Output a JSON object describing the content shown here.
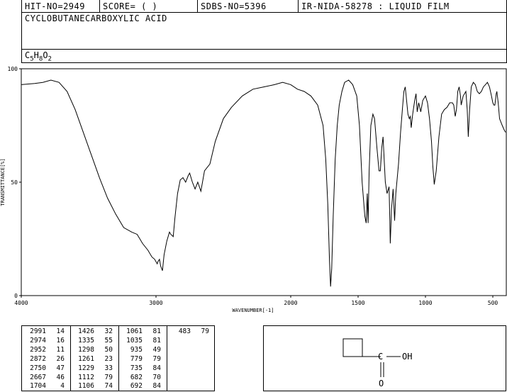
{
  "header": {
    "hit_no": "HIT-NO=2949",
    "score": "SCORE=  (   )",
    "sdbs_no": "SDBS-NO=5396",
    "ir_nida": "IR-NIDA-58278 : LIQUID FILM"
  },
  "compound": {
    "name": "CYCLOBUTANECARBOXYLIC ACID",
    "formula_parts": [
      {
        "t": "C",
        "sub": false
      },
      {
        "t": "5",
        "sub": true
      },
      {
        "t": "H",
        "sub": false
      },
      {
        "t": "8",
        "sub": true
      },
      {
        "t": "O",
        "sub": false
      },
      {
        "t": "2",
        "sub": true
      }
    ]
  },
  "chart_data": {
    "type": "line",
    "title": "",
    "xlabel": "WAVENUMBER[-1]",
    "ylabel": "TRANSMITTANCE[%]",
    "xlim": [
      4000,
      400
    ],
    "ylim": [
      0,
      100
    ],
    "x_ticks": [
      4000,
      3000,
      2000,
      1500,
      1000,
      500
    ],
    "y_ticks": [
      0,
      50,
      100
    ],
    "series": [
      {
        "points": [
          [
            4000,
            93
          ],
          [
            3900,
            93.5
          ],
          [
            3840,
            94
          ],
          [
            3780,
            95
          ],
          [
            3720,
            94
          ],
          [
            3660,
            90
          ],
          [
            3600,
            82
          ],
          [
            3540,
            72
          ],
          [
            3480,
            62
          ],
          [
            3420,
            52
          ],
          [
            3360,
            43
          ],
          [
            3300,
            36
          ],
          [
            3240,
            30
          ],
          [
            3180,
            28
          ],
          [
            3140,
            27
          ],
          [
            3100,
            23
          ],
          [
            3060,
            20
          ],
          [
            3030,
            17
          ],
          [
            3010,
            16
          ],
          [
            2991,
            14
          ],
          [
            2985,
            15
          ],
          [
            2974,
            16
          ],
          [
            2965,
            13
          ],
          [
            2952,
            11
          ],
          [
            2940,
            18
          ],
          [
            2920,
            24
          ],
          [
            2900,
            28
          ],
          [
            2890,
            27
          ],
          [
            2872,
            26
          ],
          [
            2860,
            34
          ],
          [
            2840,
            45
          ],
          [
            2820,
            51
          ],
          [
            2800,
            52
          ],
          [
            2780,
            50
          ],
          [
            2760,
            53
          ],
          [
            2750,
            54
          ],
          [
            2730,
            50
          ],
          [
            2710,
            47
          ],
          [
            2690,
            50
          ],
          [
            2667,
            46
          ],
          [
            2640,
            55
          ],
          [
            2600,
            58
          ],
          [
            2560,
            68
          ],
          [
            2500,
            78
          ],
          [
            2440,
            83
          ],
          [
            2360,
            88
          ],
          [
            2280,
            91
          ],
          [
            2200,
            92
          ],
          [
            2120,
            93
          ],
          [
            2060,
            94
          ],
          [
            2000,
            93
          ],
          [
            1950,
            91
          ],
          [
            1900,
            90
          ],
          [
            1850,
            88
          ],
          [
            1800,
            84
          ],
          [
            1760,
            75
          ],
          [
            1740,
            60
          ],
          [
            1725,
            40
          ],
          [
            1712,
            15
          ],
          [
            1704,
            4
          ],
          [
            1696,
            12
          ],
          [
            1685,
            35
          ],
          [
            1670,
            60
          ],
          [
            1655,
            75
          ],
          [
            1640,
            84
          ],
          [
            1620,
            90
          ],
          [
            1600,
            94
          ],
          [
            1570,
            95
          ],
          [
            1540,
            93
          ],
          [
            1510,
            88
          ],
          [
            1490,
            75
          ],
          [
            1470,
            50
          ],
          [
            1450,
            35
          ],
          [
            1440,
            32
          ],
          [
            1432,
            45
          ],
          [
            1426,
            32
          ],
          [
            1418,
            55
          ],
          [
            1405,
            75
          ],
          [
            1390,
            80
          ],
          [
            1378,
            78
          ],
          [
            1360,
            65
          ],
          [
            1345,
            55
          ],
          [
            1335,
            55
          ],
          [
            1325,
            65
          ],
          [
            1315,
            70
          ],
          [
            1298,
            50
          ],
          [
            1285,
            45
          ],
          [
            1270,
            48
          ],
          [
            1261,
            23
          ],
          [
            1252,
            38
          ],
          [
            1240,
            47
          ],
          [
            1229,
            33
          ],
          [
            1220,
            45
          ],
          [
            1200,
            58
          ],
          [
            1185,
            72
          ],
          [
            1170,
            83
          ],
          [
            1160,
            90
          ],
          [
            1150,
            92
          ],
          [
            1140,
            86
          ],
          [
            1130,
            80
          ],
          [
            1120,
            78
          ],
          [
            1112,
            79
          ],
          [
            1106,
            74
          ],
          [
            1095,
            80
          ],
          [
            1080,
            86
          ],
          [
            1070,
            89
          ],
          [
            1061,
            81
          ],
          [
            1050,
            85
          ],
          [
            1035,
            81
          ],
          [
            1020,
            86
          ],
          [
            1000,
            88
          ],
          [
            985,
            85
          ],
          [
            970,
            78
          ],
          [
            955,
            68
          ],
          [
            945,
            57
          ],
          [
            935,
            49
          ],
          [
            920,
            55
          ],
          [
            900,
            70
          ],
          [
            880,
            80
          ],
          [
            860,
            82
          ],
          [
            840,
            83
          ],
          [
            820,
            85
          ],
          [
            800,
            85
          ],
          [
            790,
            84
          ],
          [
            779,
            79
          ],
          [
            770,
            82
          ],
          [
            760,
            90
          ],
          [
            750,
            92
          ],
          [
            740,
            88
          ],
          [
            735,
            84
          ],
          [
            720,
            88
          ],
          [
            700,
            90
          ],
          [
            690,
            82
          ],
          [
            682,
            70
          ],
          [
            672,
            82
          ],
          [
            660,
            92
          ],
          [
            645,
            94
          ],
          [
            630,
            93
          ],
          [
            615,
            90
          ],
          [
            600,
            89
          ],
          [
            585,
            90
          ],
          [
            570,
            92
          ],
          [
            555,
            93
          ],
          [
            540,
            94
          ],
          [
            525,
            92
          ],
          [
            510,
            88
          ],
          [
            500,
            85
          ],
          [
            492,
            84
          ],
          [
            485,
            84
          ],
          [
            475,
            89
          ],
          [
            470,
            90
          ],
          [
            460,
            85
          ],
          [
            450,
            78
          ],
          [
            430,
            75
          ],
          [
            415,
            73
          ],
          [
            405,
            72
          ]
        ]
      }
    ]
  },
  "peak_table": {
    "columns": [
      [
        [
          "2991",
          "14"
        ],
        [
          "2974",
          "16"
        ],
        [
          "2952",
          "11"
        ],
        [
          "2872",
          "26"
        ],
        [
          "2750",
          "47"
        ],
        [
          "2667",
          "46"
        ],
        [
          "1704",
          "4"
        ]
      ],
      [
        [
          "1426",
          "32"
        ],
        [
          "1335",
          "55"
        ],
        [
          "1298",
          "50"
        ],
        [
          "1261",
          "23"
        ],
        [
          "1229",
          "33"
        ],
        [
          "1112",
          "79"
        ],
        [
          "1106",
          "74"
        ]
      ],
      [
        [
          "1061",
          "81"
        ],
        [
          "1035",
          "81"
        ],
        [
          "935",
          "49"
        ],
        [
          "779",
          "79"
        ],
        [
          "735",
          "84"
        ],
        [
          "682",
          "70"
        ],
        [
          "692",
          "84"
        ]
      ],
      [
        [
          "483",
          "79"
        ]
      ]
    ]
  },
  "structure": {
    "substituent_label": "OH",
    "carbonyl_o": "O"
  }
}
